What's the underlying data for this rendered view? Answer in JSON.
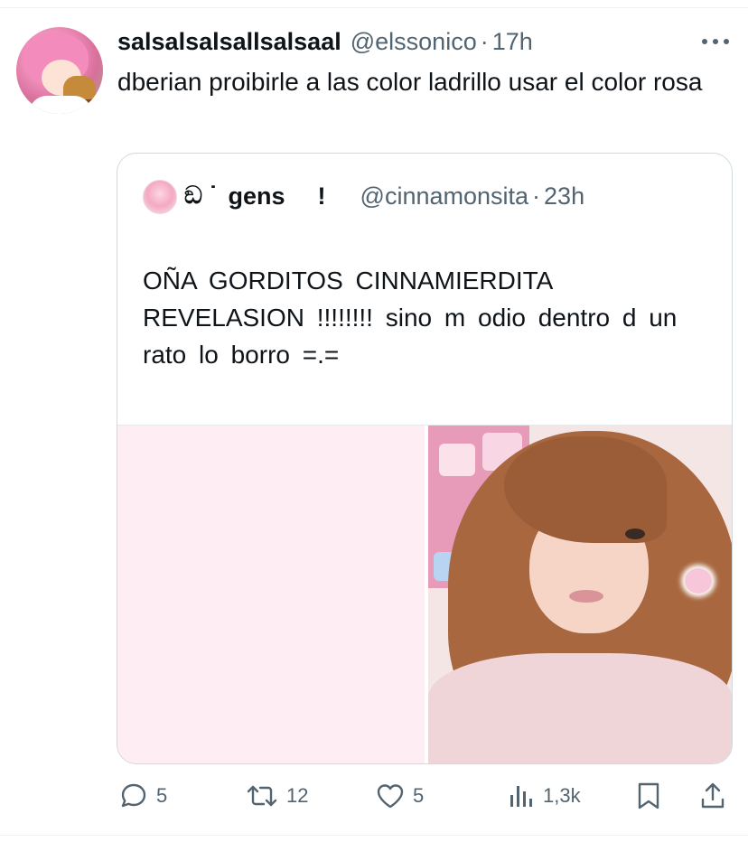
{
  "tweet": {
    "display_name": "salsalsalsallsalsaal",
    "handle": "@elssonico",
    "separator": "·",
    "time": "17h",
    "text": "dberian proibirle a las color ladrillo usar el color rosa"
  },
  "quoted_tweet": {
    "name_prefix": "ඞ ˙",
    "name_main": "gens",
    "name_suffix": "!",
    "handle": "@cinnamonsita",
    "separator": "·",
    "time": "23h",
    "text": "OÑA GORDITOS CINNAMIERDITA REVELASION !!!!!!!! sino m odio dentro d un rato lo borro =.="
  },
  "actions": {
    "replies": "5",
    "reposts": "12",
    "likes": "5",
    "views": "1,3k"
  },
  "colors": {
    "text_primary": "#0f1419",
    "text_secondary": "#536471",
    "border": "#cfd9de",
    "media_pink": "#feedf2"
  },
  "icons": [
    "more-icon",
    "reply-icon",
    "repost-icon",
    "like-icon",
    "views-icon",
    "bookmark-icon",
    "share-icon"
  ]
}
